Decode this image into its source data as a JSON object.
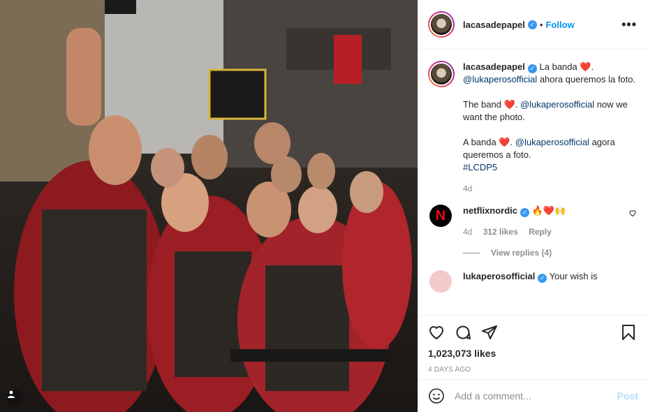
{
  "post": {
    "username": "lacasadepapel",
    "follow_label": "Follow",
    "separator": "•",
    "more_label": "•••"
  },
  "caption": {
    "username": "lacasadepapel",
    "para1_text": "La banda",
    "para1_mention": "@lukaperosofficial",
    "para1_rest": "ahora queremos la foto.",
    "para2_text": "The band",
    "para2_mention": "@lukaperosofficial",
    "para2_rest": "now we want the photo.",
    "para3_text": "A banda",
    "para3_mention": "@lukaperosofficial",
    "para3_rest": "agora queremos a foto.",
    "hashtag": "#LCDP5",
    "age": "4d",
    "heart": "❤️"
  },
  "comments": [
    {
      "username": "netflixnordic",
      "text": "🔥❤️🙌",
      "age": "4d",
      "likes": "312 likes",
      "reply": "Reply",
      "view_replies": "View replies (4)"
    },
    {
      "username": "lukaperosofficial",
      "text": "Your wish is"
    }
  ],
  "stats": {
    "likes": "1,023,073 likes",
    "posted": "4 DAYS AGO"
  },
  "add_comment": {
    "placeholder": "Add a comment...",
    "post_label": "Post"
  },
  "icons": [
    "tag-user-icon",
    "verified-icon",
    "heart-icon",
    "comment-icon",
    "share-icon",
    "bookmark-icon",
    "emoji-icon",
    "more-icon"
  ],
  "colors": {
    "link_blue": "#0095f6",
    "verified_blue": "#3897f0",
    "mention_blue": "#00376b",
    "muted": "#8e8e8e"
  }
}
